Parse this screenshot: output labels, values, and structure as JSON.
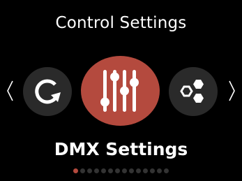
{
  "header": {
    "title": "Control Settings"
  },
  "carousel": {
    "prev_item_icon": "refresh-icon",
    "current_item_icon": "sliders-icon",
    "next_item_icon": "hexagons-icon",
    "current_label": "DMX Settings",
    "page_count": 14,
    "active_page": 1
  },
  "colors": {
    "background": "#000000",
    "accent": "#b44a3e",
    "side_circle": "#2a2a2a",
    "inactive_dot": "#333333",
    "text": "#ffffff"
  }
}
